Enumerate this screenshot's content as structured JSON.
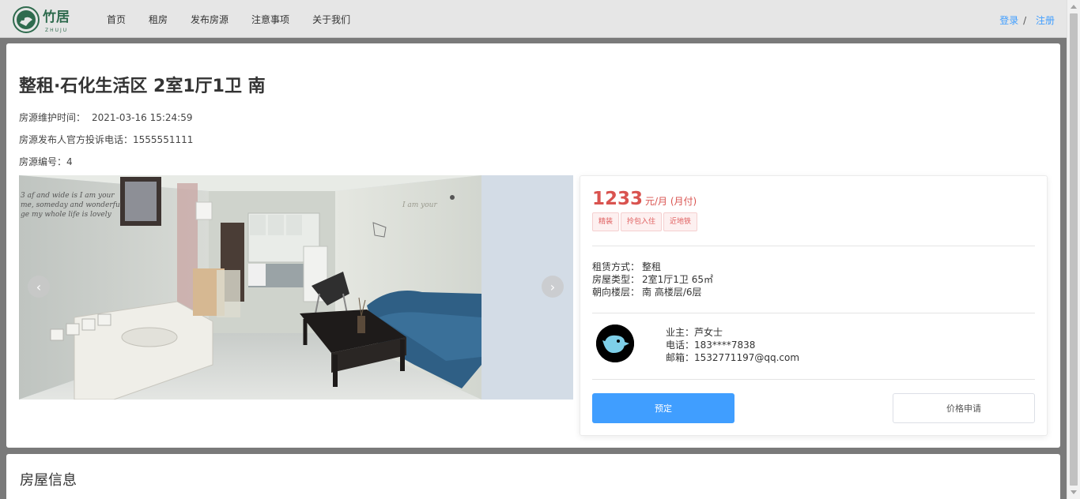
{
  "header": {
    "logo_text": "竹居",
    "logo_sub": "ZHUJU",
    "nav": [
      "首页",
      "租房",
      "发布房源",
      "注意事项",
      "关于我们"
    ],
    "login": "登录",
    "separator": "/",
    "register": "注册"
  },
  "listing": {
    "title": "整租·石化生活区 2室1厅1卫 南",
    "maintain_label": "房源维护时间：",
    "maintain_time": "2021-03-16 15:24:59",
    "phone_label": "房源发布人官方投诉电话：",
    "phone": "1555551111",
    "id_label": "房源编号：",
    "id": "4"
  },
  "carousel": {
    "prev": "‹",
    "next": "›"
  },
  "info": {
    "price": "1233",
    "unit": "元/月 (月付)",
    "tags": [
      "精装",
      "拎包入住",
      "近地铁"
    ],
    "attrs": [
      {
        "key": "租赁方式：",
        "value": "整租"
      },
      {
        "key": "房屋类型：",
        "value": "2室1厅1卫 65㎡"
      },
      {
        "key": "朝向楼层：",
        "value": "南 高楼层/6层"
      }
    ],
    "owner": "业主：芦女士",
    "tel": "电话：183****7838",
    "email": "邮箱：1532771197@qq.com",
    "book_button": "预定",
    "price_button": "价格申请"
  },
  "section": {
    "title": "房屋信息"
  },
  "colors": {
    "accent": "#409eff",
    "price": "#d9534f",
    "logo": "#2f6b4e"
  }
}
